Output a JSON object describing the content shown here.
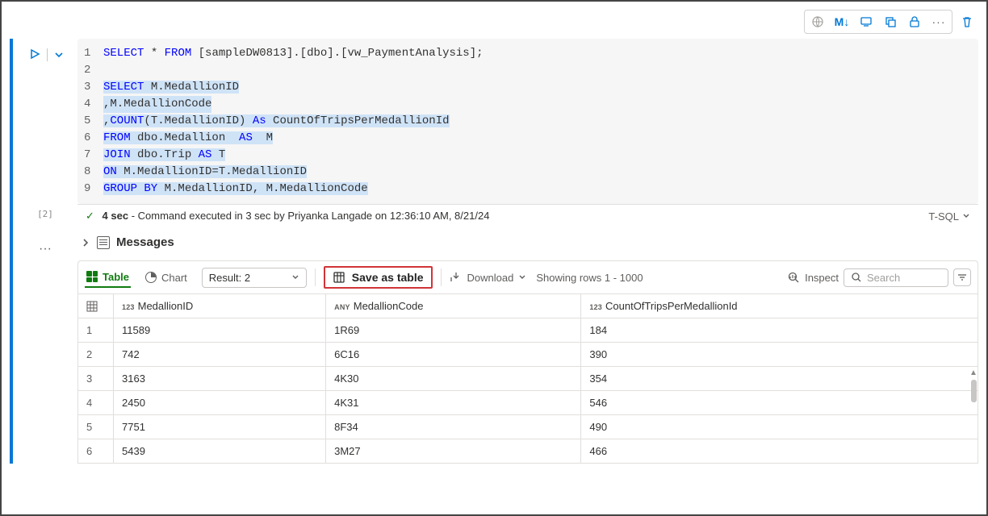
{
  "toolbar": {
    "markdown": "M↓"
  },
  "sql": {
    "l1_select": "SELECT",
    "l1_star": "*",
    "l1_from": "FROM",
    "l1_rest": " [sampleDW0813].[dbo].[vw_PaymentAnalysis];",
    "l3_select": "SELECT",
    "l3_rest": " M.MedallionID",
    "l4": ",M.MedallionCode",
    "l5_a": ",",
    "l5_count": "COUNT",
    "l5_b": "(T.MedallionID) ",
    "l5_as": "As",
    "l5_c": " CountOfTripsPerMedallionId",
    "l6_from": "FROM",
    "l6_a": " dbo.Medallion ",
    "l6_as": " AS ",
    "l6_b": " M",
    "l7_join": "JOIN",
    "l7_a": " dbo.Trip ",
    "l7_as": "AS",
    "l7_b": " T",
    "l8_on": "ON",
    "l8_a": " M.MedallionID=T.MedallionID",
    "l9_gb": "GROUP BY",
    "l9_a": " M.MedallionID, M.MedallionCode",
    "ln1": "1",
    "ln2": "2",
    "ln3": "3",
    "ln4": "4",
    "ln5": "5",
    "ln6": "6",
    "ln7": "7",
    "ln8": "8",
    "ln9": "9"
  },
  "status": {
    "index": "[2]",
    "duration": "4 sec",
    "msg": " - Command executed in 3 sec by Priyanka Langade on 12:36:10 AM, 8/21/24",
    "lang": "T-SQL"
  },
  "messages_label": "Messages",
  "results": {
    "tab_table": "Table",
    "tab_chart": "Chart",
    "result_select": "Result: 2",
    "save_as_table": "Save as table",
    "download": "Download",
    "rows_info": "Showing rows 1 - 1000",
    "inspect": "Inspect",
    "search_placeholder": "Search"
  },
  "table": {
    "type_num": "123",
    "type_any": "ANY",
    "col1": "MedallionID",
    "col2": "MedallionCode",
    "col3": "CountOfTripsPerMedallionId",
    "rows": [
      {
        "n": "1",
        "c1": "11589",
        "c2": "1R69",
        "c3": "184"
      },
      {
        "n": "2",
        "c1": "742",
        "c2": "6C16",
        "c3": "390"
      },
      {
        "n": "3",
        "c1": "3163",
        "c2": "4K30",
        "c3": "354"
      },
      {
        "n": "4",
        "c1": "2450",
        "c2": "4K31",
        "c3": "546"
      },
      {
        "n": "5",
        "c1": "7751",
        "c2": "8F34",
        "c3": "490"
      },
      {
        "n": "6",
        "c1": "5439",
        "c2": "3M27",
        "c3": "466"
      }
    ]
  }
}
